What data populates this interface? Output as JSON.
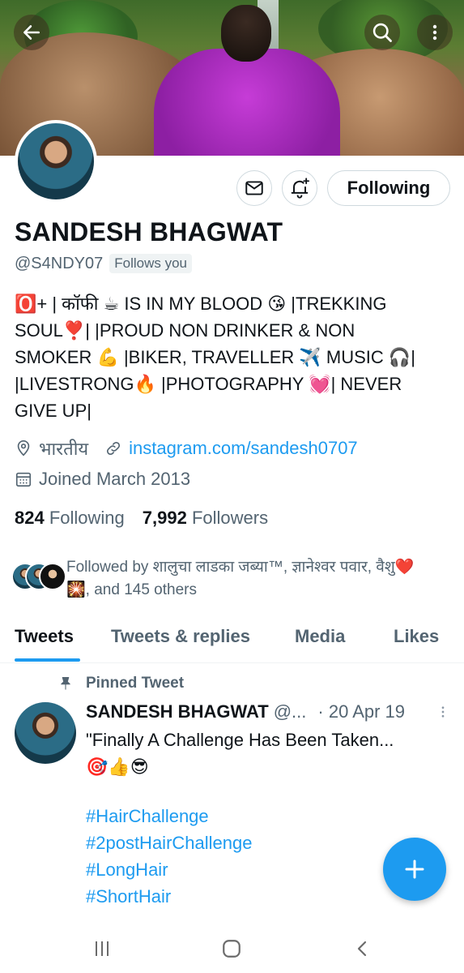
{
  "header": {
    "back_icon": "arrow-left-icon",
    "search_icon": "search-icon",
    "more_icon": "more-vertical-icon"
  },
  "profile": {
    "name": "SANDESH BHAGWAT",
    "handle": "@S4NDY07",
    "follows_you": "Follows you",
    "bio_lines": [
      "🅾️+ | कॉफी ☕ IS IN MY BLOOD 😘 |TREKKING",
      "SOUL❣️| |PROUD NON DRINKER & NON",
      "SMOKER 💪 |BIKER, TRAVELLER ✈️ MUSIC  🎧|",
      "|LIVESTRONG🔥 |PHOTOGRAPHY 💓| NEVER",
      "GIVE UP|"
    ],
    "location": "भारतीय",
    "website": "instagram.com/sandesh0707",
    "joined": "Joined March 2013"
  },
  "actions": {
    "following_label": "Following",
    "message_icon": "mail-icon",
    "notify_icon": "bell-plus-icon"
  },
  "stats": {
    "following_count": "824",
    "following_label": "Following",
    "followers_count": "7,992",
    "followers_label": "Followers"
  },
  "followed_by": {
    "line1": "Followed by शालुचा लाडका जब्या™, ज्ञानेश्वर पवार, वैशु❤️",
    "line2": "🎇, and 145 others"
  },
  "tabs": [
    {
      "label": "Tweets",
      "active": true
    },
    {
      "label": "Tweets & replies",
      "active": false
    },
    {
      "label": "Media",
      "active": false
    },
    {
      "label": "Likes",
      "active": false
    }
  ],
  "pinned_tweet": {
    "pinned_label": "Pinned Tweet",
    "author_name": "SANDESH BHAGWAT",
    "author_handle": "@...",
    "date": "· 20 Apr 19",
    "text_line1": "\"Finally A Challenge Has Been Taken...",
    "text_line2": "🎯👍😎",
    "hashtags": [
      "#HairChallenge",
      "#2postHairChallenge",
      "#LongHair",
      "#ShortHair"
    ]
  },
  "colors": {
    "accent": "#1d9bf0",
    "text_primary": "#0f1419",
    "text_secondary": "#536471",
    "border": "#cfd9de"
  }
}
